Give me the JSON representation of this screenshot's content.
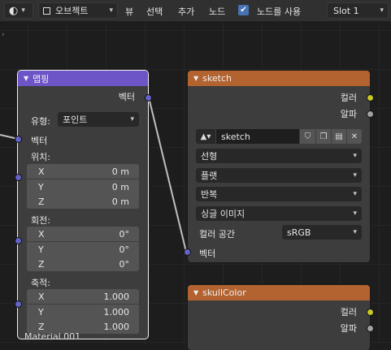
{
  "header": {
    "object_mode": "오브젝트",
    "menu": [
      "뷰",
      "선택",
      "추가",
      "노드"
    ],
    "use_nodes_checked": true,
    "use_nodes_label": "노드를 사용",
    "slot": "Slot 1"
  },
  "mapping_node": {
    "title": "맵핑",
    "output_vector": "벡터",
    "type_label": "유형:",
    "type_value": "포인트",
    "input_vector": "벡터",
    "location_label": "위치:",
    "location": [
      {
        "axis": "X",
        "value": "0 m"
      },
      {
        "axis": "Y",
        "value": "0 m"
      },
      {
        "axis": "Z",
        "value": "0 m"
      }
    ],
    "rotation_label": "회전:",
    "rotation": [
      {
        "axis": "X",
        "value": "0°"
      },
      {
        "axis": "Y",
        "value": "0°"
      },
      {
        "axis": "Z",
        "value": "0°"
      }
    ],
    "scale_label": "축적:",
    "scale": [
      {
        "axis": "X",
        "value": "1.000"
      },
      {
        "axis": "Y",
        "value": "1.000"
      },
      {
        "axis": "Z",
        "value": "1.000"
      }
    ]
  },
  "sketch_node": {
    "title": "sketch",
    "output_color": "컬러",
    "output_alpha": "알파",
    "image_name": "sketch",
    "interpolation": "선형",
    "projection": "플랫",
    "extension": "반복",
    "source": "싱글 이미지",
    "colorspace_label": "컬러 공간",
    "colorspace_value": "sRGB",
    "input_vector": "벡터"
  },
  "skull_node": {
    "title": "skullColor",
    "output_color": "컬러",
    "output_alpha": "알파"
  },
  "footer": {
    "material_name": "Material.001"
  },
  "colors": {
    "mapping_header": "#6d55c7",
    "texture_header": "#b3632f",
    "vector_socket": "#6363c7",
    "color_socket": "#c7c729",
    "checkbox": "#4772b3"
  }
}
